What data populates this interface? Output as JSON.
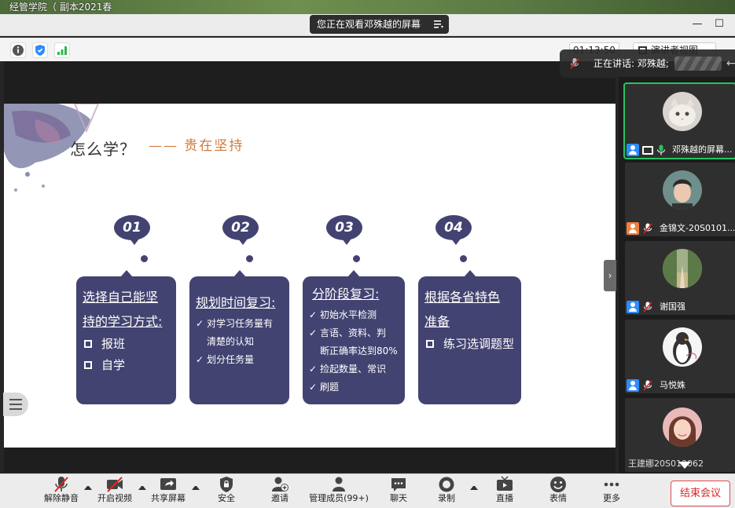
{
  "desktop": {
    "title": "经管学院（    副本2021春"
  },
  "top": {
    "share_banner": "您正在观看邓殊越的屏幕"
  },
  "info": {
    "timer": "01:13:50",
    "view_label": "演讲者视图"
  },
  "speaking": {
    "label": "正在讲话: 邓殊越;"
  },
  "slide": {
    "title": "怎么学？",
    "subtitle": "—— 贵在坚持",
    "steps": [
      {
        "num": "01",
        "head_lines": [
          "选择自己能坚",
          "持的学习方式:"
        ],
        "items": [
          "报班",
          "自学"
        ]
      },
      {
        "num": "02",
        "head": "规划时间复习:",
        "items": [
          "对学习任务量有",
          "划分任务量"
        ],
        "cont": "清楚的认知"
      },
      {
        "num": "03",
        "head": "分阶段复习:",
        "items": [
          "初始水平检测",
          "言语、资料、判",
          "捡起数量、常识",
          "刷题"
        ],
        "cont": "断正确率达到80%"
      },
      {
        "num": "04",
        "head_lines": [
          "根据各省特色",
          "准备"
        ],
        "items": [
          "练习选调题型"
        ]
      }
    ]
  },
  "gallery": {
    "participants": [
      {
        "name": "邓殊越的屏幕...",
        "badge_color": "#2d8cff"
      },
      {
        "name": "金锦文-20S0101...",
        "badge_color": "#f0803c"
      },
      {
        "name": "谢国强",
        "badge_color": "#2d8cff"
      },
      {
        "name": "马悦姝",
        "badge_color": "#2d8cff"
      },
      {
        "name": "王建娜20S010062"
      }
    ]
  },
  "toolbar": {
    "buttons": [
      "解除静音",
      "开启视频",
      "共享屏幕",
      "安全",
      "邀请",
      "管理成员(99+)",
      "聊天",
      "录制",
      "直播",
      "表情",
      "更多"
    ],
    "end_label": "结束会议"
  },
  "colors": {
    "card": "#434372",
    "accent": "#d07a3b",
    "end": "#e02424",
    "active": "#23c55e"
  }
}
